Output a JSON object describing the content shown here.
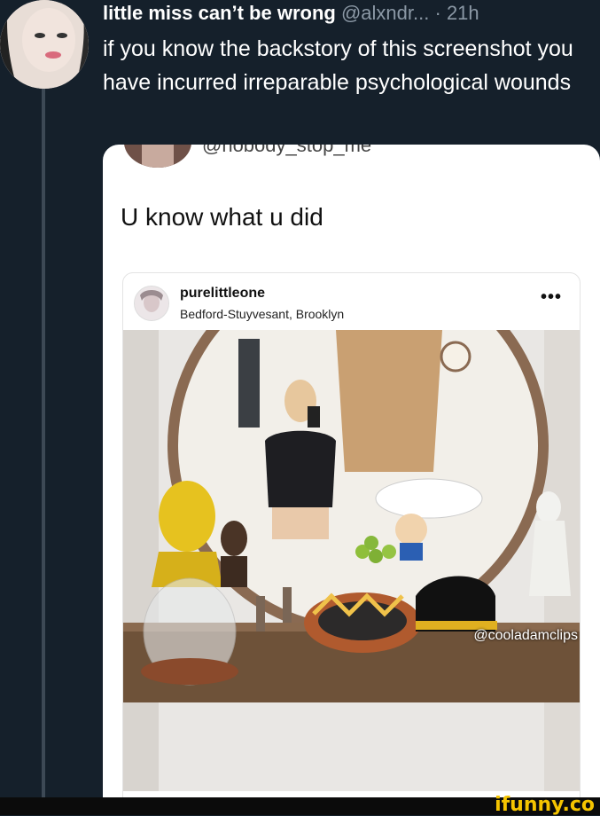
{
  "tweet": {
    "author_name": "little miss can’t be wrong",
    "author_handle": "@alxndr...",
    "separator": "·",
    "time": "21h",
    "text": "if you know the backstory of this screenshot you have incurred irreparable psychological wounds"
  },
  "quoted": {
    "handle": "@nobody_stop_me",
    "text": "U know what u did",
    "post": {
      "username": "purelittleone",
      "location": "Bedford-Stuyvesant, Brooklyn",
      "more": "•••",
      "watermark": "@cooladamclips"
    }
  },
  "footer": {
    "brand": "ifunny.co"
  },
  "colors": {
    "background": "#15202b",
    "secondary_text": "#8b98a5",
    "brand_yellow": "#f5c400"
  }
}
